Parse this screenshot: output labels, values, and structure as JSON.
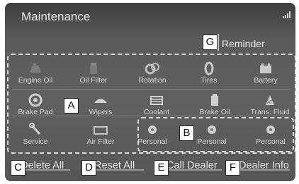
{
  "header": {
    "title": "Maintenance",
    "reminder_label": "Reminder"
  },
  "grid": {
    "row1": [
      "Engine Oil",
      "Oil Filter",
      "Rotation",
      "Tires",
      "Battery"
    ],
    "row2": [
      "Brake Pad",
      "Wipers",
      "Coolant",
      "Brake Oil",
      "Trans. Fluid"
    ],
    "row3": [
      "Service",
      "Air Filter"
    ],
    "personal": [
      "Personal",
      "Personal",
      "Personal"
    ]
  },
  "bottom": {
    "delete_all": "Delete All",
    "reset_all": "Reset All",
    "call_dealer": "Call Dealer",
    "dealer_info": "Dealer Info"
  },
  "callouts": {
    "a": "A",
    "b": "B",
    "c": "C",
    "d": "D",
    "e": "E",
    "f": "F",
    "g": "G"
  }
}
